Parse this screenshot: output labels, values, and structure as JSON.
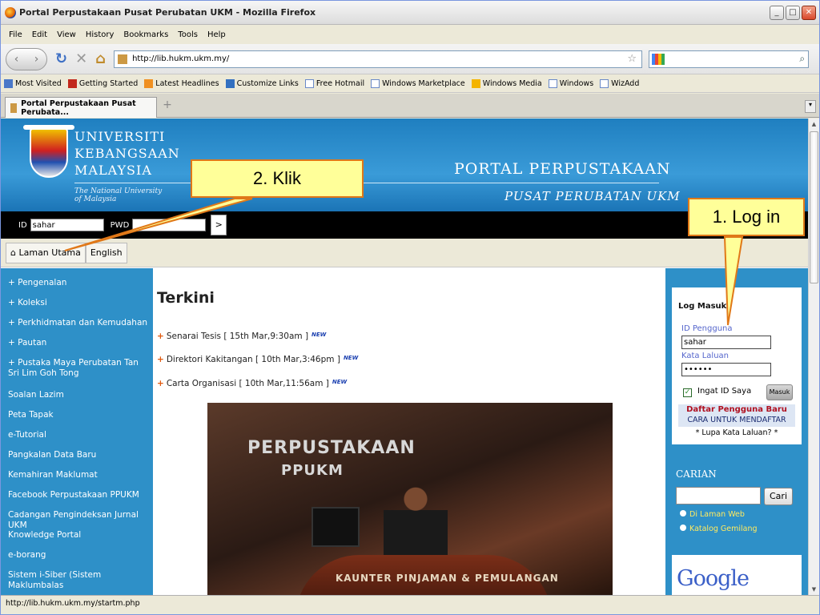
{
  "window": {
    "title": "Portal Perpustakaan Pusat Perubatan UKM - Mozilla Firefox",
    "min": "_",
    "max": "□",
    "close": "✕"
  },
  "menu": [
    "File",
    "Edit",
    "View",
    "History",
    "Bookmarks",
    "Tools",
    "Help"
  ],
  "nav": {
    "url": "http://lib.hukm.ukm.my/"
  },
  "bookmarks": [
    {
      "label": "Most Visited",
      "icon": "bookmark-icon"
    },
    {
      "label": "Getting Started",
      "icon": "firefox-icon"
    },
    {
      "label": "Latest Headlines",
      "icon": "rss-icon"
    },
    {
      "label": "Customize Links",
      "icon": "msn-icon"
    },
    {
      "label": "Free Hotmail",
      "icon": "page-icon"
    },
    {
      "label": "Windows Marketplace",
      "icon": "page-icon"
    },
    {
      "label": "Windows Media",
      "icon": "windows-icon"
    },
    {
      "label": "Windows",
      "icon": "page-icon"
    },
    {
      "label": "WizAdd",
      "icon": "page-icon"
    }
  ],
  "tab": {
    "title": "Portal Perpustakaan Pusat Perubata..."
  },
  "banner": {
    "uni_lines": [
      "UNIVERSITI",
      "KEBANGSAAN",
      "MALAYSIA"
    ],
    "tagline_1": "The National University",
    "tagline_2": "of Malaysia",
    "portal_title": "PORTAL PERPUSTAKAAN",
    "portal_sub": "PUSAT PERUBATAN UKM"
  },
  "loginstrip": {
    "id_label": "ID",
    "id_value": "sahar",
    "pwd_label": "PWD",
    "go": ">"
  },
  "topnav": {
    "home": "Laman Utama",
    "english": "English"
  },
  "leftmenu": [
    "+ Pengenalan",
    "+ Koleksi",
    "+ Perkhidmatan dan Kemudahan",
    "+ Pautan",
    "+ Pustaka Maya Perubatan Tan Sri Lim Goh Tong",
    "Soalan Lazim",
    "Peta Tapak",
    "e-Tutorial",
    "Pangkalan Data Baru",
    "Kemahiran Maklumat",
    "Facebook Perpustakaan PPUKM",
    "Cadangan Pengindeksan Jurnal UKM",
    "Knowledge Portal",
    "e-borang",
    "Sistem i-Siber (Sistem Maklumbalas"
  ],
  "center": {
    "heading": "Terkini",
    "news": [
      {
        "text": "Senarai Tesis [ 15th Mar,9:30am ]",
        "badge": "NEW"
      },
      {
        "text": "Direktori Kakitangan [ 10th Mar,3:46pm ]",
        "badge": "NEW"
      },
      {
        "text": "Carta Organisasi [ 10th Mar,11:56am ]",
        "badge": "NEW"
      }
    ],
    "photo_sign_1": "PERPUSTAKAAN",
    "photo_sign_2": "PPUKM",
    "photo_desk": "KAUNTER PINJAMAN & PEMULANGAN"
  },
  "login": {
    "title": "Log Masuk",
    "id_label": "ID Pengguna",
    "id_value": "sahar",
    "pwd_label": "Kata Laluan",
    "pwd_value": "••••••",
    "remember": "Ingat ID Saya",
    "submit": "Masuk",
    "register": "Daftar Pengguna Baru",
    "howto": "CARA UNTUK MENDAFTAR",
    "forgot": "* Lupa Kata Laluan? *"
  },
  "search": {
    "heading": "CARIAN",
    "button": "Cari",
    "option_1": "Di Laman Web",
    "option_2": "Katalog Gemilang"
  },
  "google": "Google",
  "status": "http://lib.hukm.ukm.my/startm.php",
  "callouts": {
    "klik": "2. Klik",
    "login": "1. Log in"
  }
}
